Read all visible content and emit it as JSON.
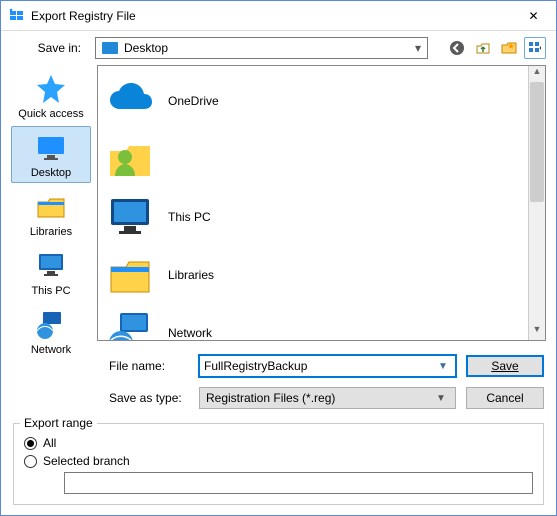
{
  "window": {
    "title": "Export Registry File",
    "close_glyph": "✕"
  },
  "toolbar": {
    "savein_label": "Save in:",
    "savein_value": "Desktop",
    "icons": {
      "back": "back-icon",
      "up": "up-one-level-icon",
      "newfolder": "new-folder-icon",
      "viewmenu": "view-menu-icon"
    }
  },
  "places": [
    {
      "id": "quick-access",
      "label": "Quick access"
    },
    {
      "id": "desktop",
      "label": "Desktop"
    },
    {
      "id": "libraries",
      "label": "Libraries"
    },
    {
      "id": "this-pc",
      "label": "This PC"
    },
    {
      "id": "network",
      "label": "Network"
    }
  ],
  "places_selected": "desktop",
  "file_list": [
    {
      "id": "onedrive",
      "label": "OneDrive"
    },
    {
      "id": "user",
      "label": ""
    },
    {
      "id": "this-pc",
      "label": "This PC"
    },
    {
      "id": "libraries",
      "label": "Libraries"
    },
    {
      "id": "network",
      "label": "Network"
    }
  ],
  "fields": {
    "filename_label": "File name:",
    "filename_value": "FullRegistryBackup",
    "filetype_label": "Save as type:",
    "filetype_value": "Registration Files (*.reg)"
  },
  "buttons": {
    "save": "Save",
    "cancel": "Cancel"
  },
  "export_range": {
    "legend": "Export range",
    "all_label": "All",
    "selected_branch_label": "Selected branch",
    "selected": "all",
    "branch_value": ""
  }
}
